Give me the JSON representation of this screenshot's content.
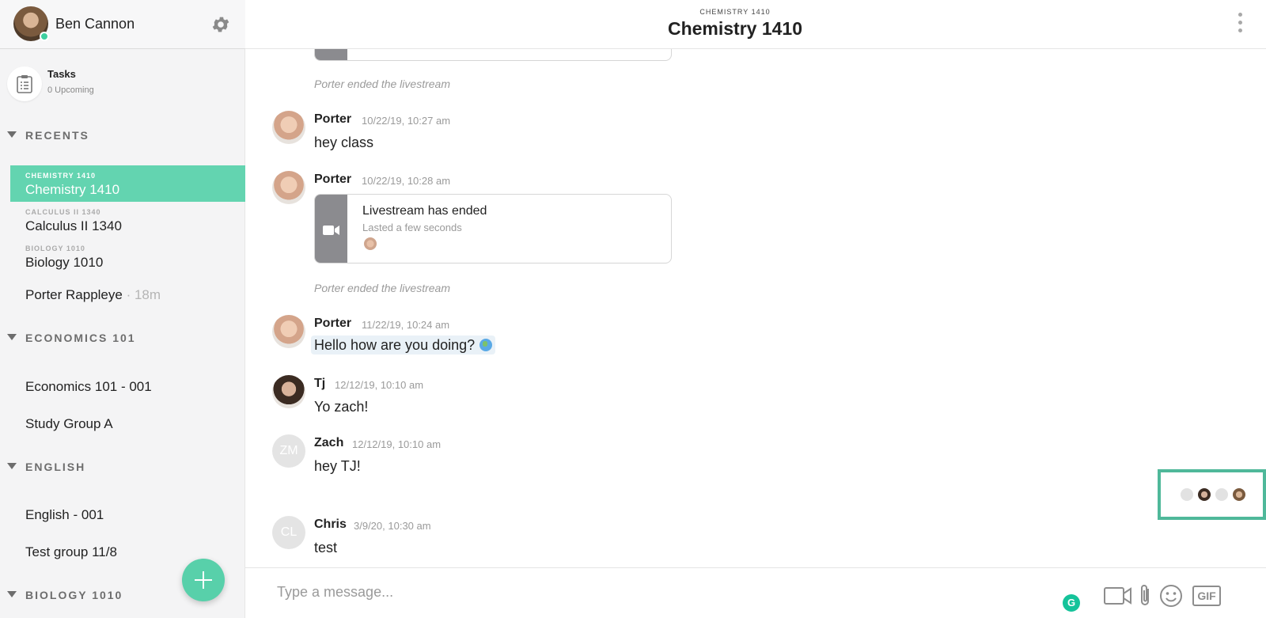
{
  "user": {
    "name": "Ben Cannon",
    "status": "online"
  },
  "tasks": {
    "title": "Tasks",
    "subtitle": "0 Upcoming"
  },
  "sidebar": {
    "sections": [
      {
        "label": "RECENTS"
      },
      {
        "label": "ECONOMICS 101"
      },
      {
        "label": "ENGLISH"
      },
      {
        "label": "BIOLOGY 1010"
      }
    ],
    "recents": [
      {
        "small": "CHEMISTRY 1410",
        "label": "Chemistry 1410",
        "active": true
      },
      {
        "small": "CALCULUS II 1340",
        "label": "Calculus II 1340"
      },
      {
        "small": "BIOLOGY 1010",
        "label": "Biology 1010"
      },
      {
        "label": "Porter Rappleye",
        "meta": "· 18m"
      }
    ],
    "economics": [
      {
        "label": "Economics 101 - 001"
      },
      {
        "label": "Study Group A"
      }
    ],
    "english": [
      {
        "label": "English - 001"
      },
      {
        "label": "Test group 11/8"
      }
    ]
  },
  "header": {
    "kicker": "CHEMISTRY 1410",
    "title": "Chemistry 1410"
  },
  "messages": {
    "event1": "Porter ended the livestream",
    "m1": {
      "author": "Porter",
      "time": "10/22/19, 10:27 am",
      "text": "hey class"
    },
    "m2": {
      "author": "Porter",
      "time": "10/22/19, 10:28 am"
    },
    "card": {
      "title": "Livestream has ended",
      "subtitle": "Lasted a few seconds"
    },
    "event2": "Porter ended the livestream",
    "m3": {
      "author": "Porter",
      "time": "11/22/19, 10:24 am",
      "text": "Hello how are you doing?"
    },
    "m4": {
      "author": "Tj",
      "time": "12/12/19, 10:10 am",
      "text": "Yo zach!"
    },
    "m5": {
      "author": "Zach",
      "initials": "ZM",
      "time": "12/12/19, 10:10 am",
      "text": "hey TJ!"
    },
    "m6": {
      "author": "Chris",
      "initials": "CL",
      "time": "3/9/20, 10:30 am",
      "text": "test"
    }
  },
  "composer": {
    "placeholder": "Type a message...",
    "gif_label": "GIF",
    "grammarly": "G"
  },
  "colors": {
    "accent": "#63d4b0",
    "fab": "#58d0aa",
    "readers_border": "#4fb89a"
  }
}
